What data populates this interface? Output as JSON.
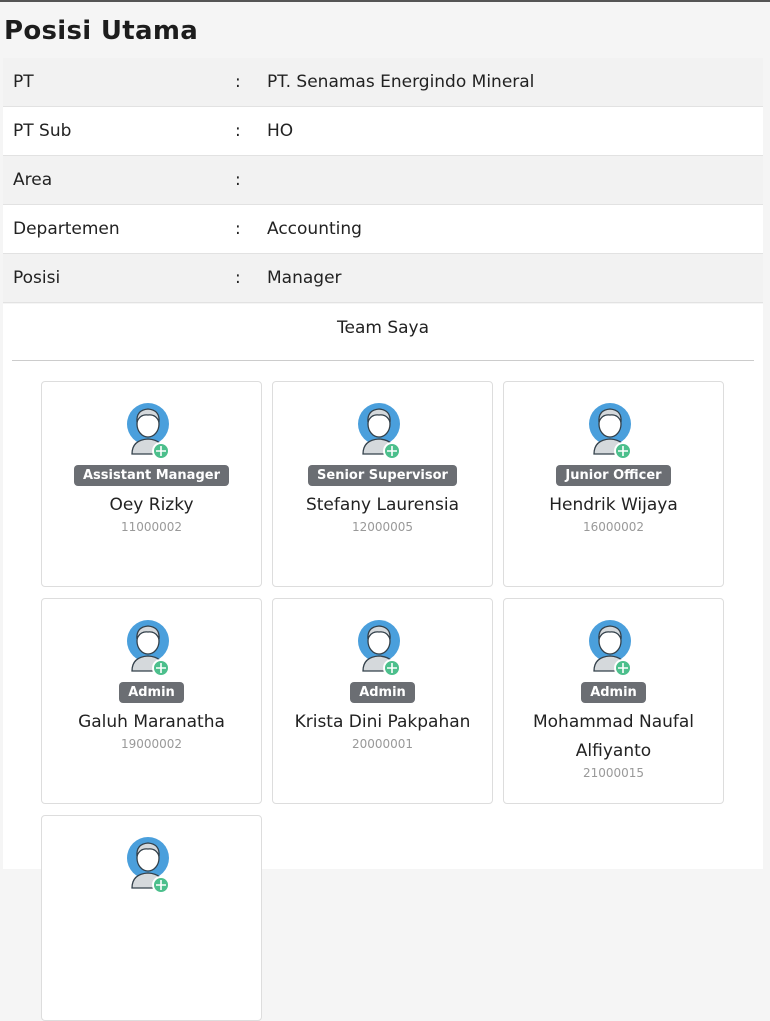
{
  "title": "Posisi Utama",
  "info": [
    {
      "label": "PT",
      "value": "PT. Senamas Energindo Mineral"
    },
    {
      "label": "PT Sub",
      "value": "HO"
    },
    {
      "label": "Area",
      "value": ""
    },
    {
      "label": "Departemen",
      "value": "Accounting"
    },
    {
      "label": "Posisi",
      "value": "Manager"
    }
  ],
  "separator": ":",
  "team_title": "Team Saya",
  "members": [
    {
      "role": "Assistant Manager",
      "name": "Oey Rizky",
      "id": "11000002"
    },
    {
      "role": "Senior Supervisor",
      "name": "Stefany Laurensia",
      "id": "12000005"
    },
    {
      "role": "Junior Officer",
      "name": "Hendrik Wijaya",
      "id": "16000002"
    },
    {
      "role": "Admin",
      "name": "Galuh Maranatha",
      "id": "19000002"
    },
    {
      "role": "Admin",
      "name": "Krista Dini Pakpahan",
      "id": "20000001"
    },
    {
      "role": "Admin",
      "name": "Mohammad Naufal Alfiyanto",
      "id": "21000015"
    },
    {}
  ],
  "colors": {
    "avatar_ring": "#4a9fdc",
    "add_badge": "#4cbf8c",
    "role_badge": "#6b6e73"
  }
}
